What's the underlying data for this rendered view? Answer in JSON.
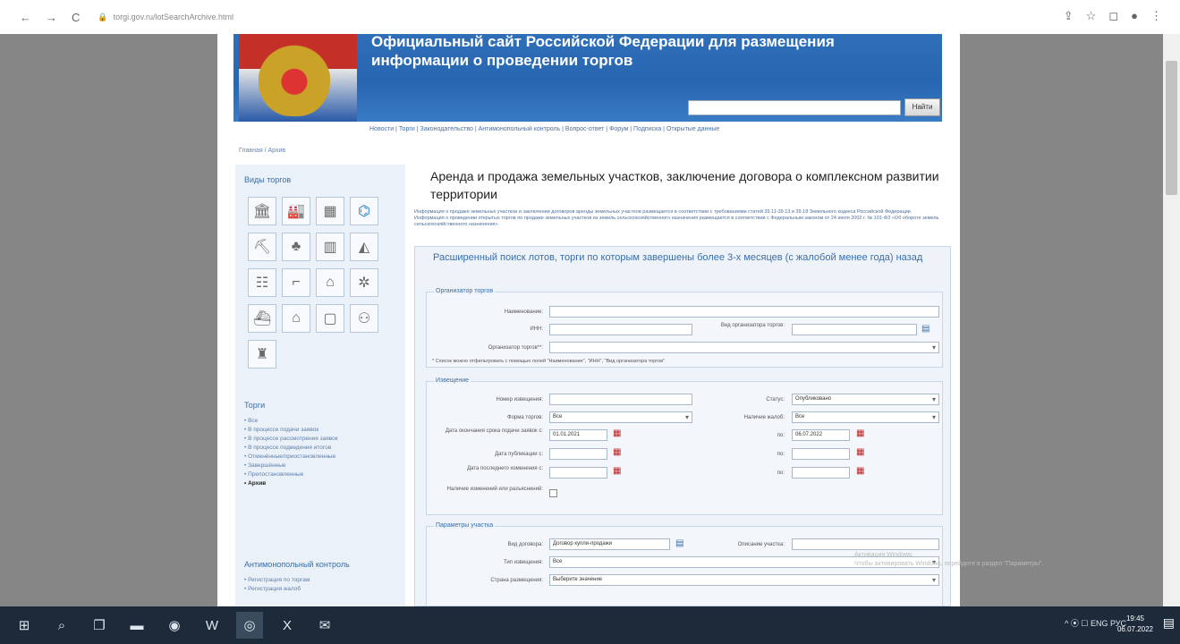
{
  "browser": {
    "url": "torgi.gov.ru/lotSearchArchive.html",
    "nav_back": "←",
    "nav_forward": "→",
    "reload": "C"
  },
  "banner": {
    "title_line1": "Официальный сайт Российской Федерации для размещения",
    "title_line2": "информации о проведении торгов",
    "search_button": "Найти"
  },
  "topnav": {
    "items": [
      "Новости",
      "Торги",
      "Законодательство",
      "Антимонопольный контроль",
      "Вопрос-ответ",
      "Форум",
      "Подписка",
      "Открытые данные"
    ]
  },
  "breadcrumb": "Главная / Архив",
  "sidebar": {
    "types_heading": "Виды торгов",
    "torgi_heading": "Торги",
    "torgi_items": [
      "Все",
      "В процессе подачи заявок",
      "В процессе рассмотрения заявок",
      "В процессе подведения итогов",
      "Отменённые/приостановленные",
      "Завершённые",
      "Препостановленные",
      "Архив"
    ],
    "anti_heading": "Антимонопольный контроль",
    "anti_items": [
      "Регистрация по торгам",
      "Регистрация жалоб"
    ]
  },
  "content": {
    "title": "Аренда и продажа земельных участков, заключение договора о комплексном развитии территории",
    "info_1": "Информация о продаже земельных участков и заключении договоров аренды земельных участков размещается в соответствии с требованиями статей 39.11-39.13 и 39.18 Земельного кодекса Российской Федерации.",
    "info_2": "Информация о проведении открытых торгов по продаже земельных участков из земель сельскохозяйственного назначения размещается в соответствии с Федеральным законом от 24 июля 2002 г. № 101-ФЗ «Об обороте земель сельскохозяйственного назначения».",
    "form_heading": "Расширенный поиск лотов, торги по которым завершены более 3-х месяцев (с жалобой менее года) назад",
    "org": {
      "legend": "Организатор торгов",
      "name_label": "Наименование:",
      "inn_label": "ИНН:",
      "type_label": "Вид организатора торгов:",
      "organizer_label": "Организатор торгов**:",
      "note": "* Список можно отфильтровать с помощью полей \"Наименование\", \"ИНН\", \"Вид организатора торгов\""
    },
    "notice": {
      "legend": "Извещение",
      "number_label": "Номер извещения:",
      "status_label": "Статус:",
      "status_value": "Опубликовано",
      "form_label": "Форма торгов:",
      "form_value": "Все",
      "type_label": "Наличие жалоб:",
      "type_value": "Все",
      "deadline_label": "Дата окончания срока подачи заявок с:",
      "deadline_from": "01.01.2021",
      "to_label": "по:",
      "deadline_to": "06.07.2022",
      "pub_label": "Дата публикации с:",
      "change_label": "Дата последнего изменения с:",
      "change_flag_label": "Наличие изменений или разъяснений:"
    },
    "params": {
      "legend": "Параметры участка",
      "contract_label": "Вид договора:",
      "contract_value": "Договор купли-продажи",
      "desc_label": "Описание участка:",
      "tender_type_label": "Тип извещения:",
      "tender_type_value": "Все",
      "country_label": "Страна размещения:",
      "country_value": "Выберите значение"
    }
  },
  "watermark": {
    "line1": "Активация Windows",
    "line2": "Чтобы активировать Windows, перейдите в раздел \"Параметры\"."
  },
  "taskbar": {
    "tray": "^ ⦿ ☐ ENG РУС",
    "time": "19:45",
    "date": "06.07.2022"
  }
}
